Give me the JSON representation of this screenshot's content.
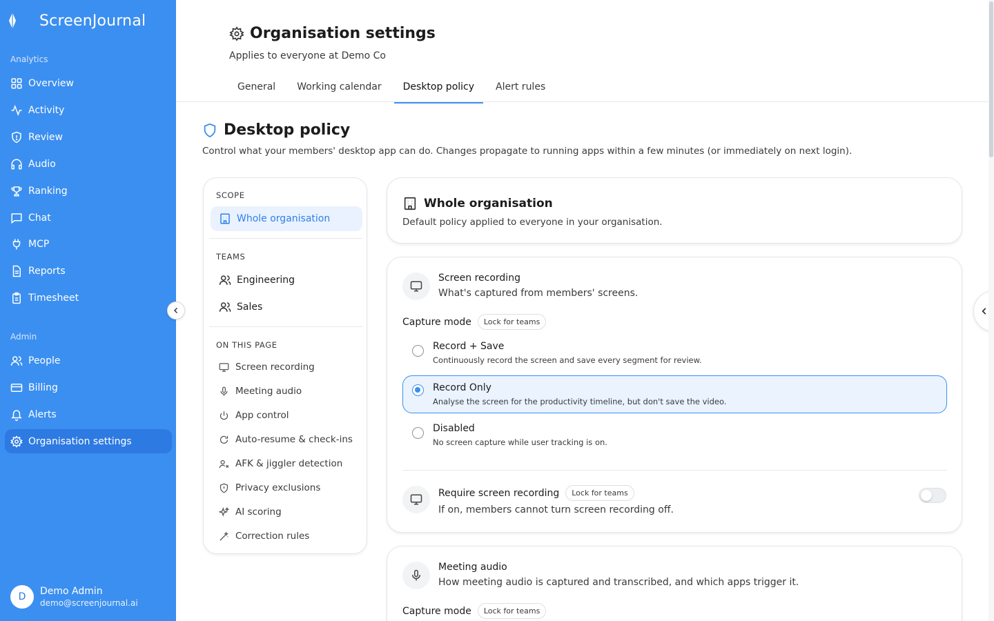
{
  "app": {
    "name": "ScreenJournal"
  },
  "sidebar": {
    "analytics_label": "Analytics",
    "admin_label": "Admin",
    "analytics_items": [
      {
        "label": "Overview",
        "icon": "grid-icon"
      },
      {
        "label": "Activity",
        "icon": "activity-icon"
      },
      {
        "label": "Review",
        "icon": "shield-icon"
      },
      {
        "label": "Audio",
        "icon": "headphones-icon"
      },
      {
        "label": "Ranking",
        "icon": "trophy-icon"
      },
      {
        "label": "Chat",
        "icon": "chat-icon"
      },
      {
        "label": "MCP",
        "icon": "plug-icon"
      },
      {
        "label": "Reports",
        "icon": "document-icon"
      },
      {
        "label": "Timesheet",
        "icon": "clipboard-icon"
      }
    ],
    "admin_items": [
      {
        "label": "People",
        "icon": "users-icon"
      },
      {
        "label": "Billing",
        "icon": "card-icon"
      },
      {
        "label": "Alerts",
        "icon": "bell-icon"
      },
      {
        "label": "Organisation settings",
        "icon": "gear-icon",
        "active": true
      }
    ],
    "user": {
      "initial": "D",
      "name": "Demo Admin",
      "email": "demo@screenjournal.ai"
    }
  },
  "header": {
    "title": "Organisation settings",
    "subtitle": "Applies to everyone at Demo Co",
    "tabs": [
      {
        "label": "General"
      },
      {
        "label": "Working calendar"
      },
      {
        "label": "Desktop policy",
        "active": true
      },
      {
        "label": "Alert rules"
      }
    ]
  },
  "policy": {
    "title": "Desktop policy",
    "description": "Control what your members' desktop app can do. Changes propagate to running apps within a few minutes (or immediately on next login)."
  },
  "scope": {
    "scope_label": "SCOPE",
    "org_item": "Whole organisation",
    "teams_label": "TEAMS",
    "teams": [
      "Engineering",
      "Sales"
    ],
    "toc_label": "ON THIS PAGE",
    "toc": [
      {
        "label": "Screen recording",
        "icon": "monitor-icon"
      },
      {
        "label": "Meeting audio",
        "icon": "microphone-icon"
      },
      {
        "label": "App control",
        "icon": "power-icon"
      },
      {
        "label": "Auto-resume & check-ins",
        "icon": "refresh-icon"
      },
      {
        "label": "AFK & jiggler detection",
        "icon": "user-x-icon"
      },
      {
        "label": "Privacy exclusions",
        "icon": "shield-icon"
      },
      {
        "label": "AI scoring",
        "icon": "sparkles-icon"
      },
      {
        "label": "Correction rules",
        "icon": "wand-icon"
      }
    ]
  },
  "org_card": {
    "title": "Whole organisation",
    "description": "Default policy applied to everyone in your organisation."
  },
  "screen_recording": {
    "title": "Screen recording",
    "description": "What's captured from members' screens.",
    "capture_label": "Capture mode",
    "lock_label": "Lock for teams",
    "selected": "Record Only",
    "options": [
      {
        "title": "Record + Save",
        "desc": "Continuously record the screen and save every segment for review."
      },
      {
        "title": "Record Only",
        "desc": "Analyse the screen for the productivity timeline, but don't save the video."
      },
      {
        "title": "Disabled",
        "desc": "No screen capture while user tracking is on."
      }
    ],
    "require": {
      "title": "Require screen recording",
      "lock_label": "Lock for teams",
      "description": "If on, members cannot turn screen recording off.",
      "enabled": false
    }
  },
  "meeting_audio": {
    "title": "Meeting audio",
    "description": "How meeting audio is captured and transcribed, and which apps trigger it.",
    "capture_label": "Capture mode",
    "lock_label": "Lock for teams"
  },
  "colors": {
    "accent": "#3b8ff0",
    "sidebar": "#3b8ff0",
    "selected_bg": "#eaf3fe"
  }
}
